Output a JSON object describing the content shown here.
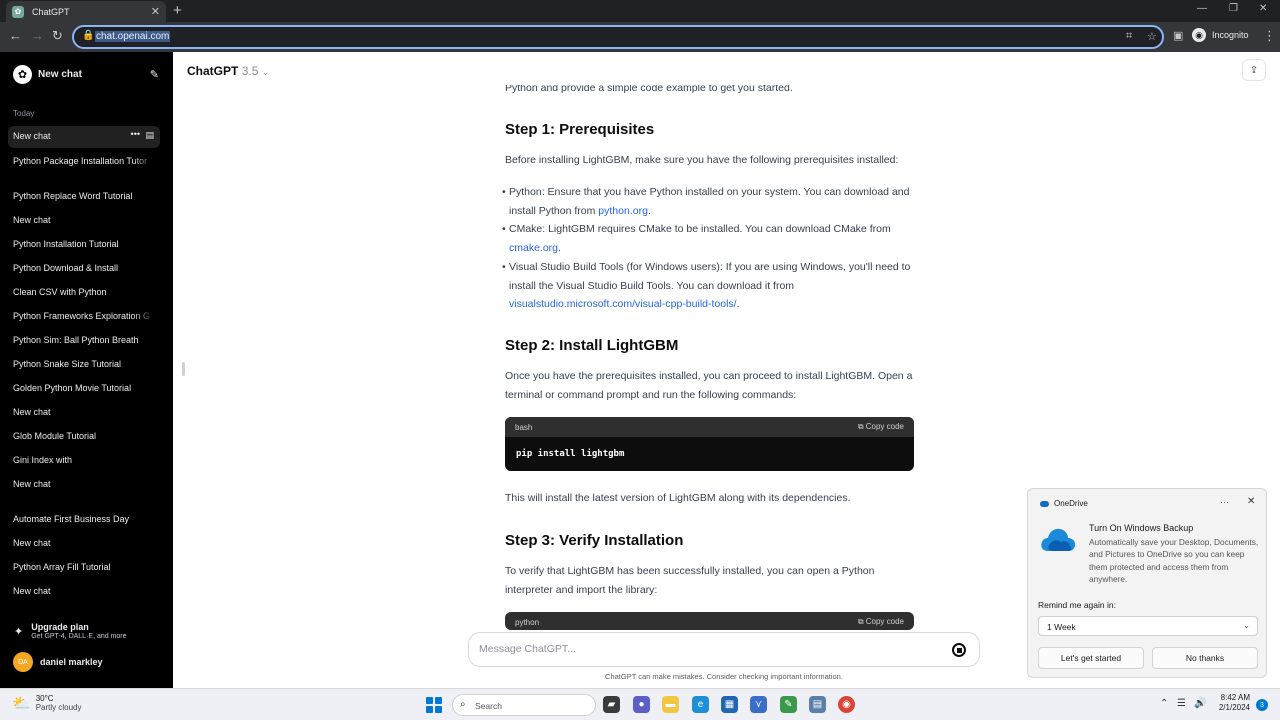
{
  "browser": {
    "tab_title": "ChatGPT",
    "url": "chat.openai.com",
    "profile_label": "Incognito"
  },
  "sidebar": {
    "new_chat": "New chat",
    "section_today": "Today",
    "items": [
      "New chat",
      "Python Package Installation Tutor",
      "Python Replace Word Tutorial",
      "New chat",
      "Python Installation Tutorial",
      "Python Download & Install",
      "Clean CSV with Python",
      "Python Frameworks Exploration G",
      "Python Sim: Ball Python Breath",
      "Python Snake Size Tutorial",
      "Golden Python Movie Tutorial",
      "New chat",
      "Glob Module Tutorial",
      "Gini Index with",
      "New chat",
      "Automate First Business Day",
      "New chat",
      "Python Array Fill Tutorial",
      "New chat"
    ],
    "upgrade_title": "Upgrade plan",
    "upgrade_sub": "Get GPT-4, DALL·E, and more",
    "user_initials": "DA",
    "user_name": "daniel markley"
  },
  "header": {
    "model_name": "ChatGPT",
    "model_version": "3.5"
  },
  "conversation": {
    "intro_tail": "Python and provide a simple code example to get you started.",
    "step1_title": "Step 1: Prerequisites",
    "step1_text": "Before installing LightGBM, make sure you have the following prerequisites installed:",
    "bullet1_a": "Python: Ensure that you have Python installed on your system. You can download and install Python from ",
    "bullet1_link": "python.org",
    "bullet2_a": "CMake: LightGBM requires CMake to be installed. You can download CMake from ",
    "bullet2_link": "cmake.org",
    "bullet3_a": "Visual Studio Build Tools (for Windows users): If you are using Windows, you'll need to install the Visual Studio Build Tools. You can download it from ",
    "bullet3_link": "visualstudio.microsoft.com/visual-cpp-build-tools/",
    "step2_title": "Step 2: Install LightGBM",
    "step2_text": "Once you have the prerequisites installed, you can proceed to install LightGBM. Open a terminal or command prompt and run the following commands:",
    "code1_lang": "bash",
    "code_copy": "Copy code",
    "code1_body": "pip install lightgbm",
    "step2_after": "This will install the latest version of LightGBM along with its dependencies.",
    "step3_title": "Step 3: Verify Installation",
    "step3_text": "To verify that LightGBM has been successfully installed, you can open a Python interpreter and import the library:",
    "code2_lang": "python"
  },
  "composer": {
    "placeholder": "Message ChatGPT...",
    "disclaimer": "ChatGPT can make mistakes. Consider checking important information."
  },
  "toast": {
    "app": "OneDrive",
    "title": "Turn On Windows Backup",
    "body": "Automatically save your Desktop, Documents, and Pictures to OneDrive so you can keep them protected and access them from anywhere.",
    "remind_label": "Remind me again in:",
    "remind_value": "1 Week",
    "primary_btn": "Let's get started",
    "secondary_btn": "No thanks"
  },
  "taskbar": {
    "weather_temp": "30°C",
    "weather_desc": "Partly cloudy",
    "search_label": "Search",
    "time": "8:42 AM",
    "date": "2/1/2024",
    "notification_count": "3"
  }
}
